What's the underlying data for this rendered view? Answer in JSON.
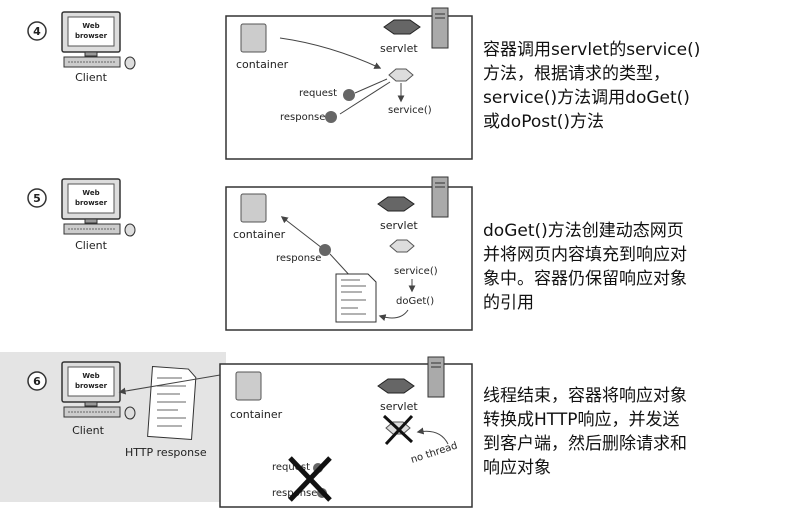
{
  "steps": [
    {
      "number": "4",
      "browser_label": "Web browser",
      "client_label": "Client",
      "container_label": "container",
      "servlet_label": "servlet",
      "request_label": "request",
      "response_label": "response",
      "method_label": "service()",
      "description": [
        "容器调用servlet的service()",
        "方法，根据请求的类型，",
        "service()方法调用doGet()",
        "或doPost()方法"
      ]
    },
    {
      "number": "5",
      "browser_label": "Web browser",
      "client_label": "Client",
      "container_label": "container",
      "servlet_label": "servlet",
      "response_label": "response",
      "method_label": "service()",
      "method2_label": "doGet()",
      "description": [
        "doGet()方法创建动态网页",
        "并将网页内容填充到响应对",
        "象中。容器仍保留响应对象",
        "的引用"
      ]
    },
    {
      "number": "6",
      "browser_label": "Web browser",
      "client_label": "Client",
      "http_label": "HTTP response",
      "container_label": "container",
      "servlet_label": "servlet",
      "request_label": "request",
      "response_label": "response",
      "thread_label": "no thread",
      "description": [
        "线程结束，容器将响应对象",
        "转换成HTTP响应，并发送",
        "到客户端，然后删除请求和",
        "响应对象"
      ]
    }
  ]
}
